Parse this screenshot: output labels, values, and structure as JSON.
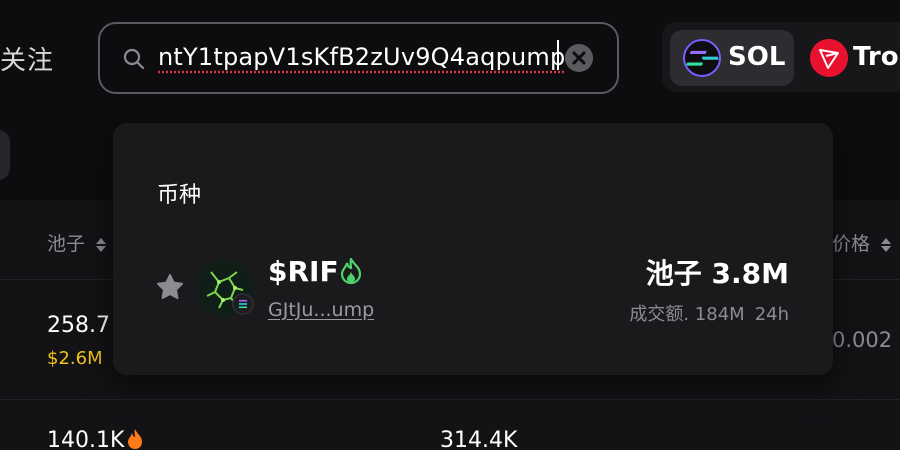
{
  "header": {
    "follow_label": "关注",
    "search": {
      "value": "ntY1tpapV1sKfB2zUv9Q4aqpump"
    },
    "chains": [
      {
        "label": "SOL",
        "icon": "solana-icon",
        "selected": true
      },
      {
        "label": "Tro",
        "icon": "tron-icon",
        "selected": false
      }
    ]
  },
  "dropdown": {
    "section_label": "币种",
    "results": [
      {
        "symbol": "$RIF",
        "hot": true,
        "address": "GJtJu...ump",
        "pool_label": "池子 3.8M",
        "volume_label": "成交额. 184M",
        "volume_period": "24h"
      }
    ]
  },
  "table": {
    "columns": {
      "pool": "池子",
      "price": "价格"
    },
    "rows": [
      {
        "pool": "258.7",
        "pool_usd": "$2.6M",
        "price": "0.002"
      },
      {
        "pool": "140.1K",
        "hot": true,
        "mid": "314.4K"
      }
    ]
  },
  "colors": {
    "background": "#0d0d0f",
    "accent_yellow": "#f0c419",
    "fire_green": "#4fd16b",
    "fire_orange": "#ff7a1a",
    "error_underline": "#d63a3a"
  }
}
